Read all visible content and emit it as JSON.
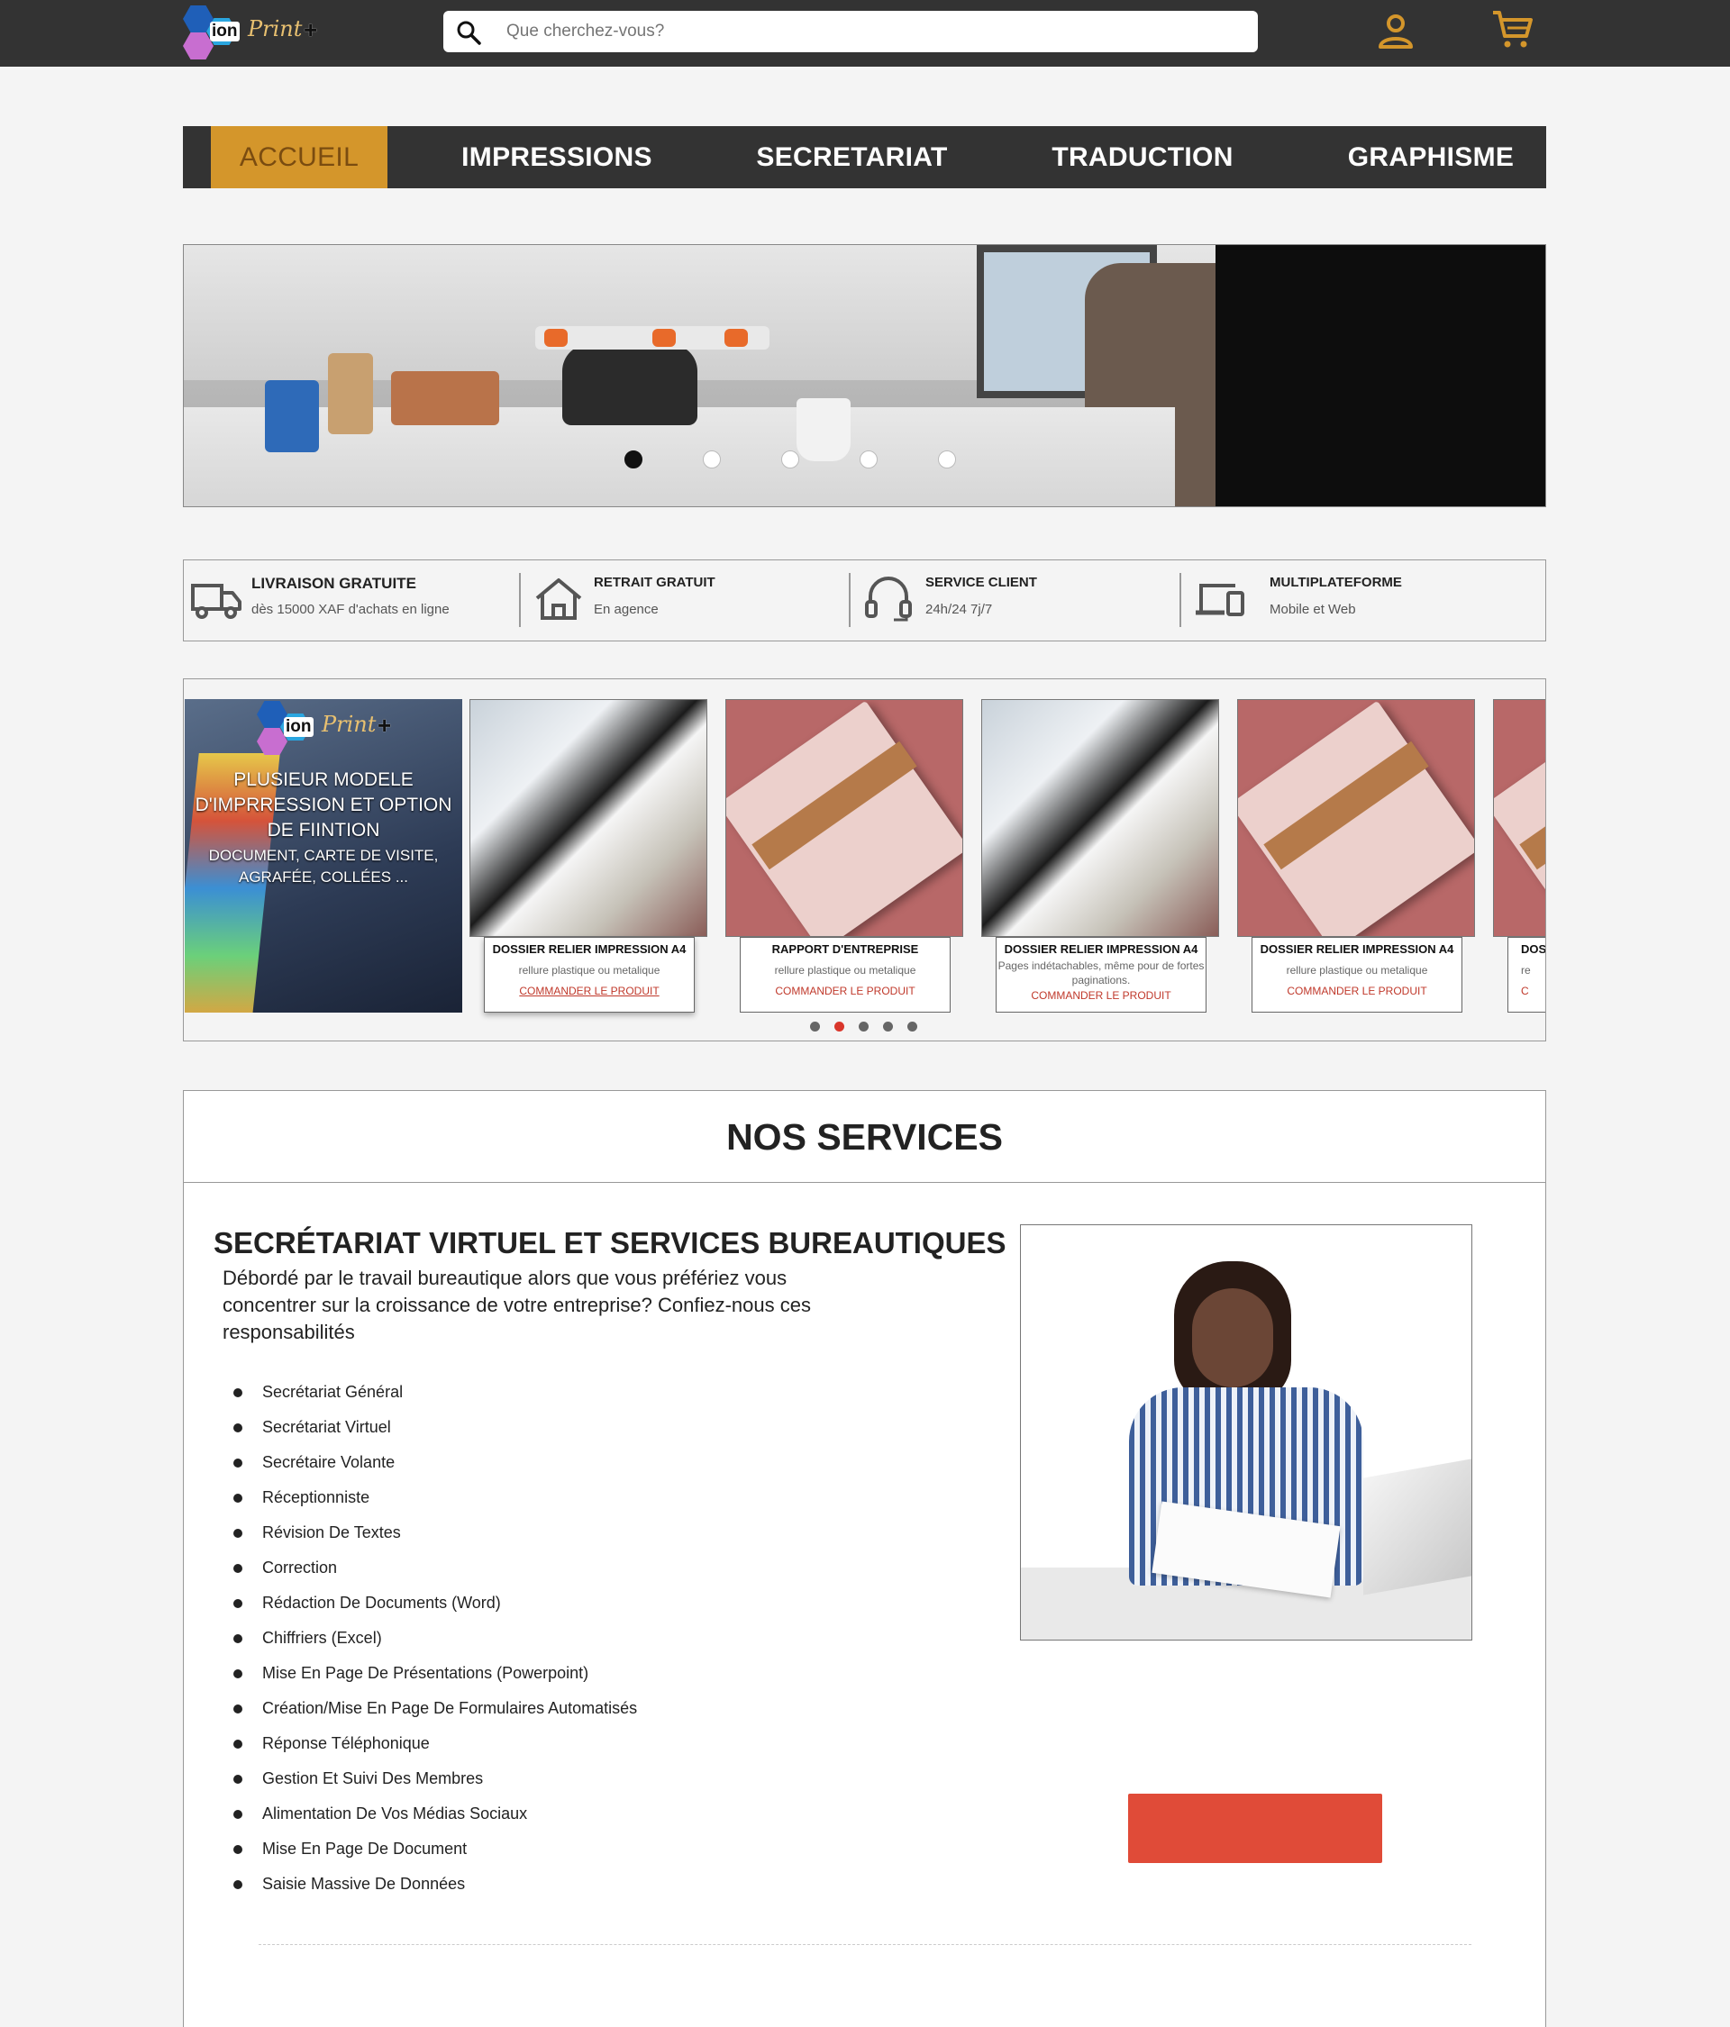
{
  "header": {
    "logo": {
      "ion": "ion",
      "print": "Print",
      "plus": "+"
    },
    "search_placeholder": "Que cherchez-vous?"
  },
  "nav": {
    "items": [
      {
        "label": "ACCUEIL",
        "active": true
      },
      {
        "label": "IMPRESSIONS",
        "active": false
      },
      {
        "label": "SECRETARIAT",
        "active": false
      },
      {
        "label": "TRADUCTION",
        "active": false
      },
      {
        "label": "GRAPHISME",
        "active": false
      }
    ]
  },
  "banner": {
    "slides": 5,
    "active_slide": 1
  },
  "features": [
    {
      "icon": "truck-icon",
      "title": "LIVRAISON GRATUITE",
      "subtitle": "dès 15000 XAF d'achats en ligne"
    },
    {
      "icon": "home-icon",
      "title": "RETRAIT GRATUIT",
      "subtitle": "En agence"
    },
    {
      "icon": "headset-icon",
      "title": "SERVICE CLIENT",
      "subtitle": "24h/24 7j/7"
    },
    {
      "icon": "devices-icon",
      "title": "MULTIPLATEFORME",
      "subtitle": "Mobile et Web"
    }
  ],
  "products": {
    "promo": {
      "headline": "PLUSIEUR MODELE D'IMPRRESSION ET OPTION DE FIINTION",
      "subline": "DOCUMENT, CARTE DE VISITE, AGRAFÉE, COLLÉES ..."
    },
    "cards": [
      {
        "title": "DOSSIER RELIER IMPRESSION A4",
        "subtitle": "rellure plastique ou metalique",
        "link": "COMMANDER LE PRODUIT",
        "image": "binder"
      },
      {
        "title": "RAPPORT D'ENTREPRISE",
        "subtitle": "rellure plastique ou metalique",
        "link": "COMMANDER LE PRODUIT",
        "image": "notebook"
      },
      {
        "title": "DOSSIER RELIER IMPRESSION A4",
        "subtitle": "Pages indétachables, même pour de fortes paginations.",
        "link": "COMMANDER LE PRODUIT",
        "image": "binder"
      },
      {
        "title": "DOSSIER RELIER IMPRESSION A4",
        "subtitle": "rellure plastique ou metalique",
        "link": "COMMANDER LE PRODUIT",
        "image": "notebook"
      },
      {
        "title": "DOS",
        "subtitle": "re",
        "link": "C",
        "image": "notebook"
      }
    ],
    "pager": {
      "count": 5,
      "active": 1
    }
  },
  "services": {
    "heading": "NOS SERVICES",
    "title": "SECRÉTARIAT VIRTUEL ET SERVICES BUREAUTIQUES",
    "description": "Débordé par le travail bureautique alors que vous préfériez vous concentrer sur la croissance de votre entreprise? Confiez-nous ces responsabilités",
    "items": [
      "Secrétariat Général",
      "Secrétariat Virtuel",
      "Secrétaire Volante",
      "Réceptionniste",
      "Révision De Textes",
      "Correction",
      "Rédaction De Documents (Word)",
      "Chiffriers (Excel)",
      "Mise En Page De Présentations (Powerpoint)",
      "Création/Mise En Page De Formulaires Automatisés",
      "Réponse Téléphonique",
      "Gestion Et Suivi Des Membres",
      "Alimentation De Vos Médias Sociaux",
      "Mise En Page De Document",
      "Saisie Massive De Données"
    ]
  },
  "colors": {
    "accent": "#d4962b",
    "dark": "#333333",
    "cta": "#e04b38",
    "link": "#c0392b"
  }
}
